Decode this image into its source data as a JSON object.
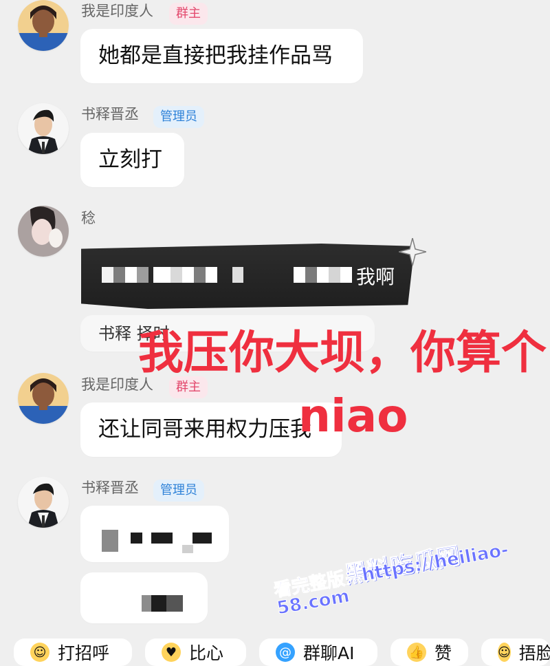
{
  "messages": [
    {
      "sender": "我是印度人",
      "badge": "群主",
      "text": "她都是直接把我挂作品骂"
    },
    {
      "sender": "书释晋丞",
      "badge": "管理员",
      "text": "立刻打"
    },
    {
      "sender": "稔",
      "dark_text": "我啊",
      "reply_text": "书释 择时"
    },
    {
      "sender": "我是印度人",
      "badge": "群主",
      "text": "还让同哥来用权力压我"
    },
    {
      "sender": "书释晋丞",
      "badge": "管理员"
    }
  ],
  "overlay": {
    "title": "我压你大坝，你算个",
    "subtitle": "niao"
  },
  "watermark": {
    "brand": "黑料吃瓜网",
    "url": "看完整版：https://heiliao-58.com"
  },
  "quick_actions": [
    {
      "label": "打招呼",
      "icon": "smile-icon"
    },
    {
      "label": "比心",
      "icon": "heart-icon"
    },
    {
      "label": "群聊AI",
      "icon": "at-icon"
    },
    {
      "label": "赞",
      "icon": "thumb-icon"
    },
    {
      "label": "捂脸",
      "icon": "facepalm-icon"
    }
  ],
  "colors": {
    "overlay_red": "#ef2f3f",
    "owner_badge": "#e3476c",
    "admin_badge": "#2f82d8",
    "watermark_blue": "#6a73ff"
  }
}
